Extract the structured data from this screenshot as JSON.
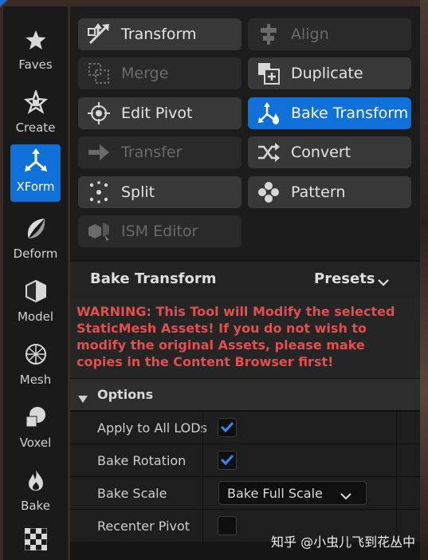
{
  "sidebar": {
    "items": [
      {
        "label": "Faves",
        "icon": "star-icon",
        "active": false
      },
      {
        "label": "Create",
        "icon": "sparkle-cube-icon",
        "active": false
      },
      {
        "label": "XForm",
        "icon": "transform-axes-icon",
        "active": true
      },
      {
        "label": "Deform",
        "icon": "deform-crescent-icon",
        "active": false
      },
      {
        "label": "Model",
        "icon": "cube-icon",
        "active": false
      },
      {
        "label": "Mesh",
        "icon": "wire-sphere-icon",
        "active": false
      },
      {
        "label": "Voxel",
        "icon": "voxel-blob-icon",
        "active": false
      },
      {
        "label": "Bake",
        "icon": "flame-icon",
        "active": false
      }
    ]
  },
  "tools": {
    "transform": {
      "label": "Transform",
      "state": "enabled"
    },
    "align": {
      "label": "Align",
      "state": "disabled"
    },
    "merge": {
      "label": "Merge",
      "state": "disabled"
    },
    "duplicate": {
      "label": "Duplicate",
      "state": "enabled"
    },
    "edit_pivot": {
      "label": "Edit Pivot",
      "state": "enabled"
    },
    "bake_transform": {
      "label": "Bake Transform",
      "state": "active"
    },
    "transfer": {
      "label": "Transfer",
      "state": "disabled"
    },
    "convert": {
      "label": "Convert",
      "state": "enabled"
    },
    "split": {
      "label": "Split",
      "state": "enabled"
    },
    "pattern": {
      "label": "Pattern",
      "state": "enabled"
    },
    "ism_editor": {
      "label": "ISM Editor",
      "state": "disabled"
    }
  },
  "panel": {
    "title": "Bake Transform",
    "presets_label": "Presets",
    "warning": "WARNING: This Tool will Modify the selected StaticMesh Assets! If you do not wish to modify the original Assets, please make copies in the Content Browser first!"
  },
  "options": {
    "title": "Options",
    "apply_lods": {
      "label": "Apply to All LODs",
      "checked": true
    },
    "bake_rotation": {
      "label": "Bake Rotation",
      "checked": true
    },
    "bake_scale": {
      "label": "Bake Scale",
      "value": "Bake Full Scale"
    },
    "recenter_pivot": {
      "label": "Recenter Pivot",
      "checked": false
    }
  },
  "watermark": "知乎 @小虫儿飞到花丛中",
  "colors": {
    "accent": "#0e70d8",
    "warning": "#e05050"
  }
}
